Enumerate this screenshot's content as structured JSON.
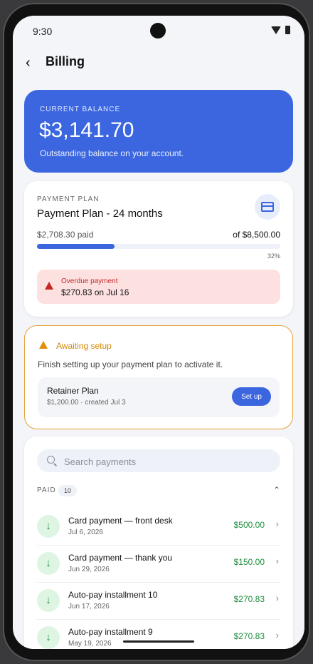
{
  "status_bar": {
    "time": "9:30"
  },
  "header": {
    "title": "Billing",
    "back_icon": "chevron-left-icon"
  },
  "balance": {
    "label": "CURRENT BALANCE",
    "amount": "$3,141.70",
    "subtitle": "Outstanding balance on your account."
  },
  "plan": {
    "label": "PAYMENT PLAN",
    "name": "Payment Plan - 24 months",
    "paid": "$2,708.30 paid",
    "total": "of $8,500.00",
    "percent_text": "32%",
    "progress": 0.32,
    "icon": "credit-card-icon",
    "overdue": {
      "title": "Overdue payment",
      "detail": "$270.83 on Jul 16"
    }
  },
  "setup": {
    "heading": "Awaiting setup",
    "description": "Finish setting up your payment plan to activate it.",
    "plan_name": "Retainer Plan",
    "plan_meta": "$1,200.00 · created Jul 3",
    "button_label": "Set up"
  },
  "payments": {
    "search_placeholder": "Search payments",
    "section_label": "PAID",
    "section_count": "10",
    "rows": [
      {
        "title": "Card payment — front desk",
        "date": "Jul 6, 2026",
        "amount": "$500.00"
      },
      {
        "title": "Card payment — thank you",
        "date": "Jun 29, 2026",
        "amount": "$150.00"
      },
      {
        "title": "Auto-pay installment 10",
        "date": "Jun 17, 2026",
        "amount": "$270.83"
      },
      {
        "title": "Auto-pay installment 9",
        "date": "May 19, 2026",
        "amount": "$270.83"
      }
    ]
  },
  "colors": {
    "primary": "#3b66e0",
    "success": "#1e8e3e",
    "danger": "#c62828",
    "warning": "#e6a23c"
  }
}
